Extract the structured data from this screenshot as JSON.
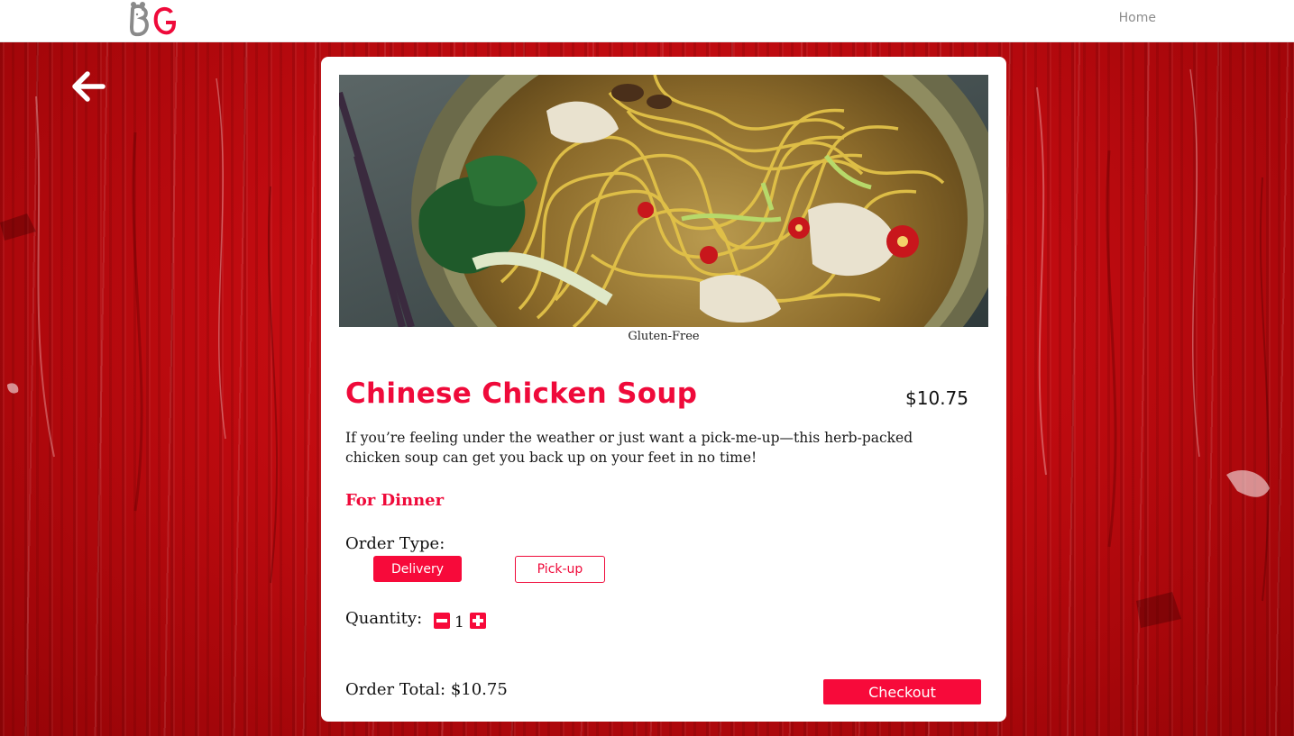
{
  "header": {
    "logo_icon": "bg-monogram-logo",
    "nav": {
      "home_label": "Home"
    }
  },
  "page": {
    "back_icon": "arrow-left-icon"
  },
  "product": {
    "image_icon": "noodle-soup-bowl-photo",
    "dietary_tag": "Gluten-Free",
    "name": "Chinese Chicken Soup",
    "price": "$10.75",
    "description": "If you’re feeling under the weather or just want a pick-me-up—this herb-packed chicken soup can get you back up on your feet in no time!",
    "meal": "For Dinner"
  },
  "order": {
    "type_label": "Order Type:",
    "types": [
      {
        "label": "Delivery",
        "selected": true
      },
      {
        "label": "Pick-up",
        "selected": false
      }
    ],
    "quantity_label": "Quantity:",
    "quantity": "1",
    "total_label": "Order Total: $10.75",
    "checkout_label": "Checkout"
  },
  "colors": {
    "accent": "#f70a3a",
    "background": "#c00b10",
    "card": "#ffffff"
  }
}
